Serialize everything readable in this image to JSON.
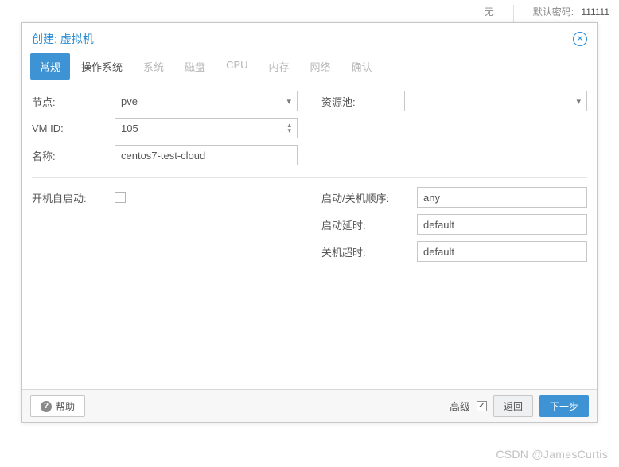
{
  "background": {
    "none_label": "无",
    "default_pw_label": "默认密码:",
    "default_pw_value": "111111"
  },
  "modal": {
    "title": "创建: 虚拟机",
    "tabs": [
      {
        "label": "常规",
        "state": "active"
      },
      {
        "label": "操作系统",
        "state": "enabled"
      },
      {
        "label": "系统",
        "state": "disabled"
      },
      {
        "label": "磁盘",
        "state": "disabled"
      },
      {
        "label": "CPU",
        "state": "disabled"
      },
      {
        "label": "内存",
        "state": "disabled"
      },
      {
        "label": "网络",
        "state": "disabled"
      },
      {
        "label": "确认",
        "state": "disabled"
      }
    ],
    "left": {
      "node_label": "节点:",
      "node_value": "pve",
      "vmid_label": "VM ID:",
      "vmid_value": "105",
      "name_label": "名称:",
      "name_value": "centos7-test-cloud"
    },
    "right": {
      "pool_label": "资源池:",
      "pool_value": ""
    },
    "advanced": {
      "autostart_label": "开机自启动:",
      "autostart_checked": false,
      "order_label": "启动/关机顺序:",
      "order_value": "any",
      "delay_label": "启动延时:",
      "delay_value": "default",
      "timeout_label": "关机超时:",
      "timeout_value": "default"
    },
    "footer": {
      "help": "帮助",
      "advanced_label": "高级",
      "advanced_checked": true,
      "back": "返回",
      "next": "下一步"
    }
  },
  "watermark": "CSDN @JamesCurtis"
}
